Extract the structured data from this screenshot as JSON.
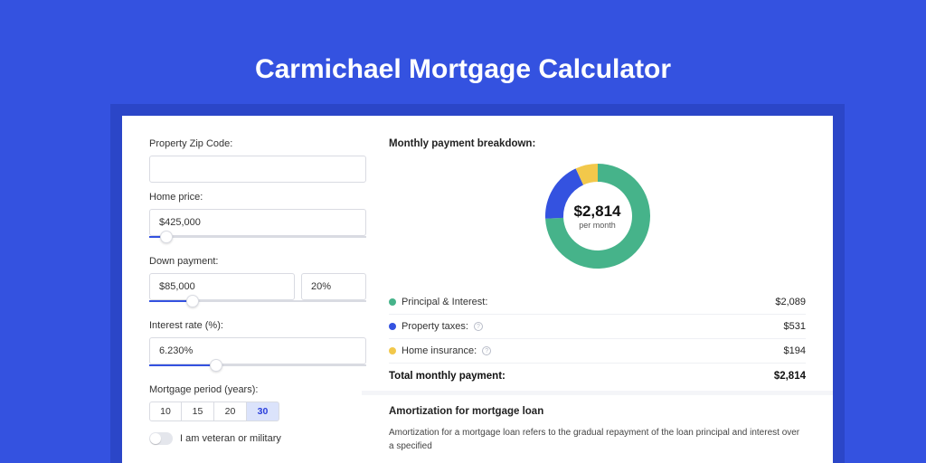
{
  "title": "Carmichael Mortgage Calculator",
  "left": {
    "zip_label": "Property Zip Code:",
    "zip_value": "",
    "price_label": "Home price:",
    "price_value": "$425,000",
    "price_slider_pct": 8,
    "down_label": "Down payment:",
    "down_value": "$85,000",
    "down_pct_value": "20%",
    "down_slider_pct": 20,
    "rate_label": "Interest rate (%):",
    "rate_value": "6.230%",
    "rate_slider_pct": 31,
    "period_label": "Mortgage period (years):",
    "periods": [
      "10",
      "15",
      "20",
      "30"
    ],
    "period_selected_index": 3,
    "vet_label": "I am veteran or military"
  },
  "right": {
    "breakdown_label": "Monthly payment breakdown:",
    "donut_amount": "$2,814",
    "donut_sub": "per month",
    "legend": [
      {
        "label": "Principal & Interest:",
        "value": "$2,089",
        "color": "#46b38a",
        "info": false
      },
      {
        "label": "Property taxes:",
        "value": "$531",
        "color": "#3452e0",
        "info": true
      },
      {
        "label": "Home insurance:",
        "value": "$194",
        "color": "#f2c84b",
        "info": true
      }
    ],
    "total_label": "Total monthly payment:",
    "total_value": "$2,814",
    "amort_head": "Amortization for mortgage loan",
    "amort_text": "Amortization for a mortgage loan refers to the gradual repayment of the loan principal and interest over a specified"
  },
  "chart_data": {
    "type": "pie",
    "series": [
      {
        "name": "Principal & Interest",
        "value": 2089,
        "color": "#46b38a"
      },
      {
        "name": "Property taxes",
        "value": 531,
        "color": "#3452e0"
      },
      {
        "name": "Home insurance",
        "value": 194,
        "color": "#f2c84b"
      }
    ],
    "total": 2814,
    "center_label": "$2,814",
    "center_sub": "per month"
  }
}
